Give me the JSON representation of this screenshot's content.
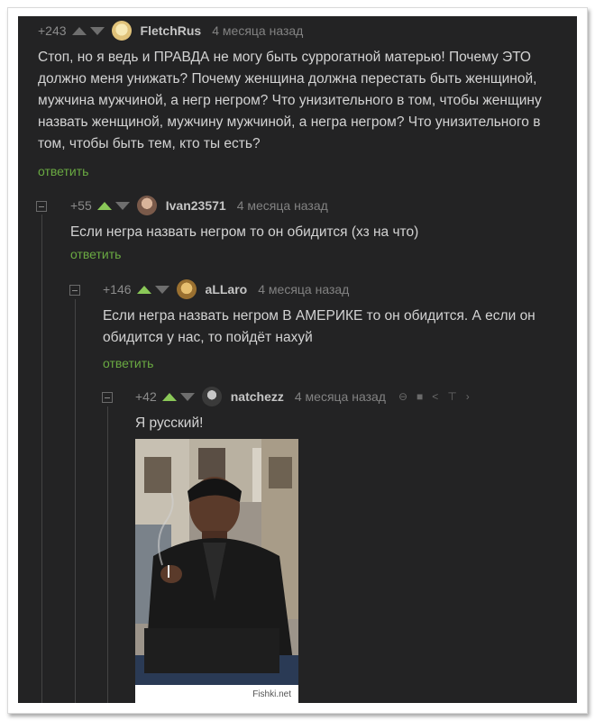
{
  "comments": [
    {
      "score": "+243",
      "author": "FletchRus",
      "time": "4 месяца назад",
      "text": "Стоп, но я ведь и ПРАВДА не могу быть суррогатной матерью! Почему ЭТО должно меня унижать? Почему женщина должна перестать быть женщиной, мужчина мужчиной, а негр негром? Что унизительного в том, чтобы женщину назвать женщиной, мужчину мужчиной, а негра негром? Что унизительного в том, чтобы быть тем, кто ты есть?",
      "reply": "ответить"
    },
    {
      "score": "+55",
      "author": "Ivan23571",
      "time": "4 месяца назад",
      "text": "Если негра назвать негром то он обидится (хз на что)",
      "reply": "ответить"
    },
    {
      "score": "+146",
      "author": "aLLaro",
      "time": "4 месяца назад",
      "text": "Если негра назвать негром В АМЕРИКЕ то он обидится. А если он обидится у нас, то пойдёт нахуй",
      "reply": "ответить"
    },
    {
      "score": "+42",
      "author": "natchezz",
      "time": "4 месяца назад",
      "text": "Я русский!",
      "image_caption": "Fishki.net"
    }
  ],
  "colors": {
    "background": "#232324",
    "reply_link": "#6aaa42",
    "upvote_active": "#8ac858"
  }
}
